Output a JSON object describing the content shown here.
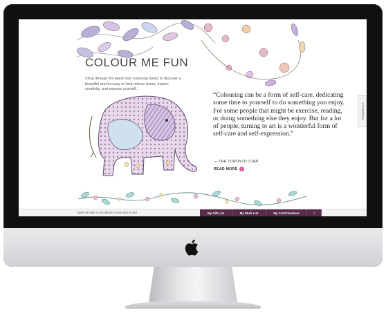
{
  "hero": {
    "title": "COLOUR ME FUN",
    "intro": "Shop through the latest new colouring books to discover a beautiful and fun way to help relieve stress, inspire creativity, and express yourself."
  },
  "quote": {
    "text": "“Colouring can be a form of self-care, dedicating some time to yourself to do something you enjoy. For some people that might be exercise, reading, or doing something else they enjoy. But for a lot of people, turning to art is a wonderful form of self-care and self-expression.”",
    "attribution": "— THE TORONTO STAR",
    "read_more": "READ MORE"
  },
  "feedback": {
    "label": "FEEDBACK"
  },
  "bottom_bar": {
    "hint": "Open the tabs to see what's in your lists or cart",
    "tabs": [
      {
        "label": "My Gift List"
      },
      {
        "label": "My Wish List"
      },
      {
        "label": "My Cart/Checkout"
      }
    ],
    "up_icon": "↑"
  },
  "icons": {
    "read_more": "chevron-right-icon",
    "device_logo": "apple-logo"
  },
  "colors": {
    "accent_purple": "#5a2a4b",
    "accent_pink": "#d9589a"
  }
}
